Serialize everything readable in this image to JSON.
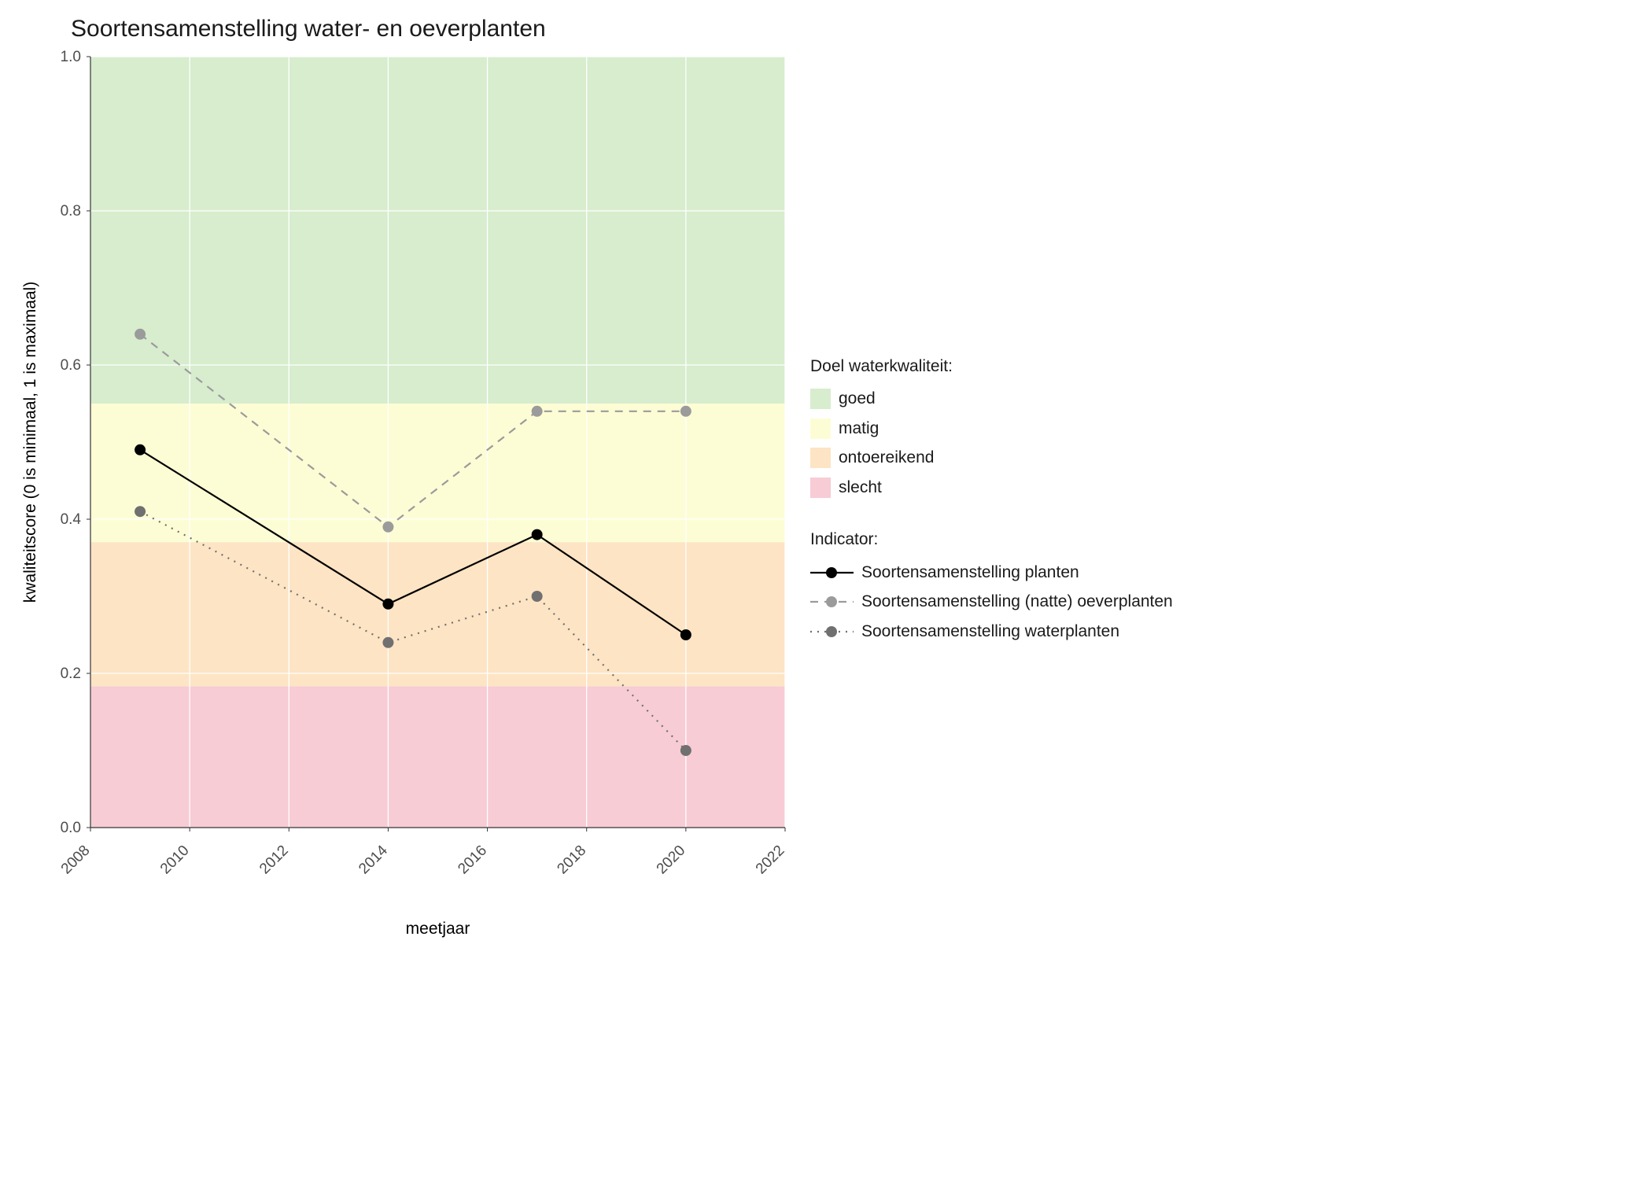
{
  "chart_data": {
    "type": "line",
    "title": "Soortensamenstelling water- en oeverplanten",
    "xlabel": "meetjaar",
    "ylabel": "kwaliteitscore (0 is minimaal, 1 is maximaal)",
    "xlim": [
      2008,
      2022
    ],
    "ylim": [
      0.0,
      1.0
    ],
    "x_ticks": [
      2008,
      2010,
      2012,
      2014,
      2016,
      2018,
      2020,
      2022
    ],
    "y_ticks": [
      0.0,
      0.2,
      0.4,
      0.6,
      0.8,
      1.0
    ],
    "bands": [
      {
        "name": "goed",
        "from": 0.55,
        "to": 1.0,
        "color": "#d7edce"
      },
      {
        "name": "matig",
        "from": 0.37,
        "to": 0.55,
        "color": "#fdfdd5"
      },
      {
        "name": "ontoereikend",
        "from": 0.183,
        "to": 0.37,
        "color": "#fde4c4"
      },
      {
        "name": "slecht",
        "from": 0.0,
        "to": 0.183,
        "color": "#f7ccd5"
      }
    ],
    "series": [
      {
        "name": "Soortensamenstelling planten",
        "style": "solid",
        "color": "#000000",
        "x": [
          2009,
          2014,
          2017,
          2020
        ],
        "y": [
          0.49,
          0.29,
          0.38,
          0.25
        ]
      },
      {
        "name": "Soortensamenstelling (natte) oeverplanten",
        "style": "dashed",
        "color": "#9b9b9b",
        "x": [
          2009,
          2014,
          2017,
          2020
        ],
        "y": [
          0.64,
          0.39,
          0.54,
          0.54
        ]
      },
      {
        "name": "Soortensamenstelling waterplanten",
        "style": "dotted",
        "color": "#707070",
        "x": [
          2009,
          2014,
          2017,
          2020
        ],
        "y": [
          0.41,
          0.24,
          0.3,
          0.1
        ]
      }
    ]
  },
  "legend_bands_title": "Doel waterkwaliteit:",
  "legend_series_title": "Indicator:"
}
